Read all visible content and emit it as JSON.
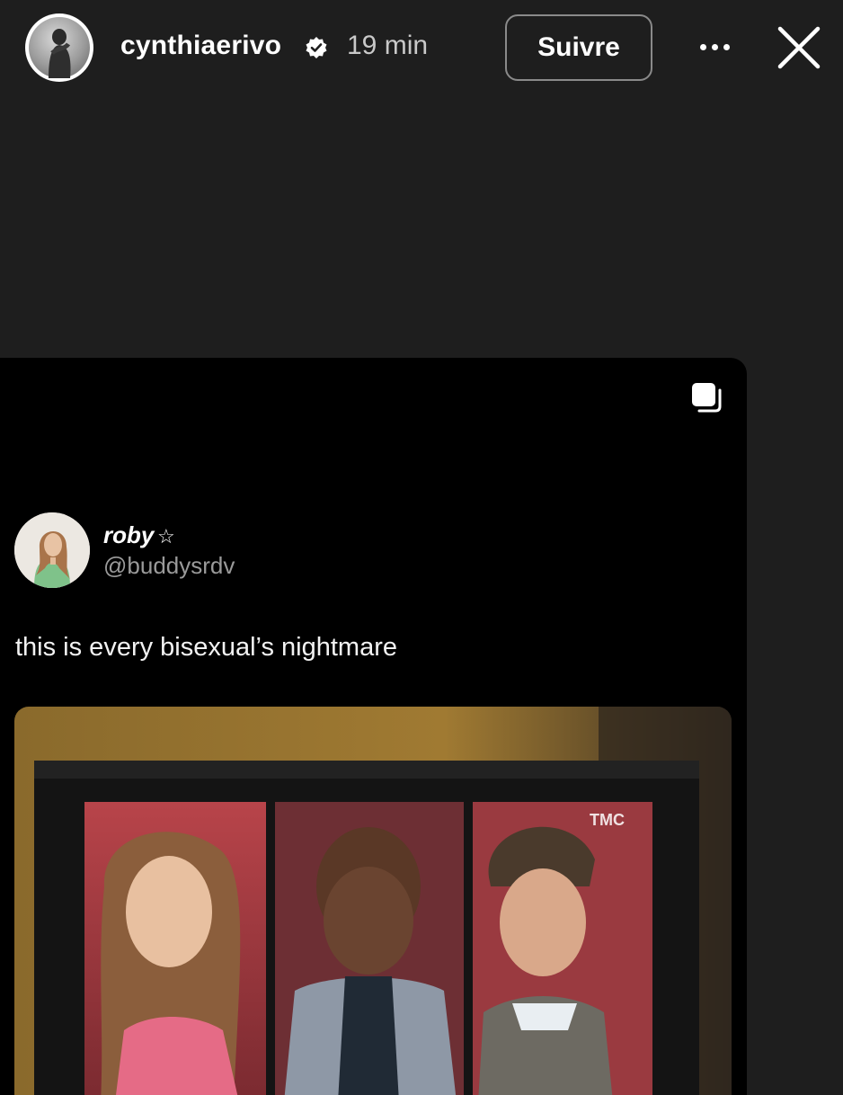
{
  "story": {
    "username": "cynthiaerivo",
    "time_ago": "19 min",
    "follow_label": "Suivre"
  },
  "tweet": {
    "display_name": "roby",
    "badge_symbol": "☆",
    "handle": "@buddysrdv",
    "text": "this is every bisexual’s nightmare",
    "photo_channel_logo": "TMC"
  },
  "colors": {
    "background": "#1e1e1e",
    "card": "#000000",
    "follow_border": "#8a8a8a",
    "handle": "#9a9a9a"
  },
  "icons": [
    "verified-badge-icon",
    "more-options-icon",
    "close-icon",
    "carousel-icon",
    "star-icon"
  ]
}
